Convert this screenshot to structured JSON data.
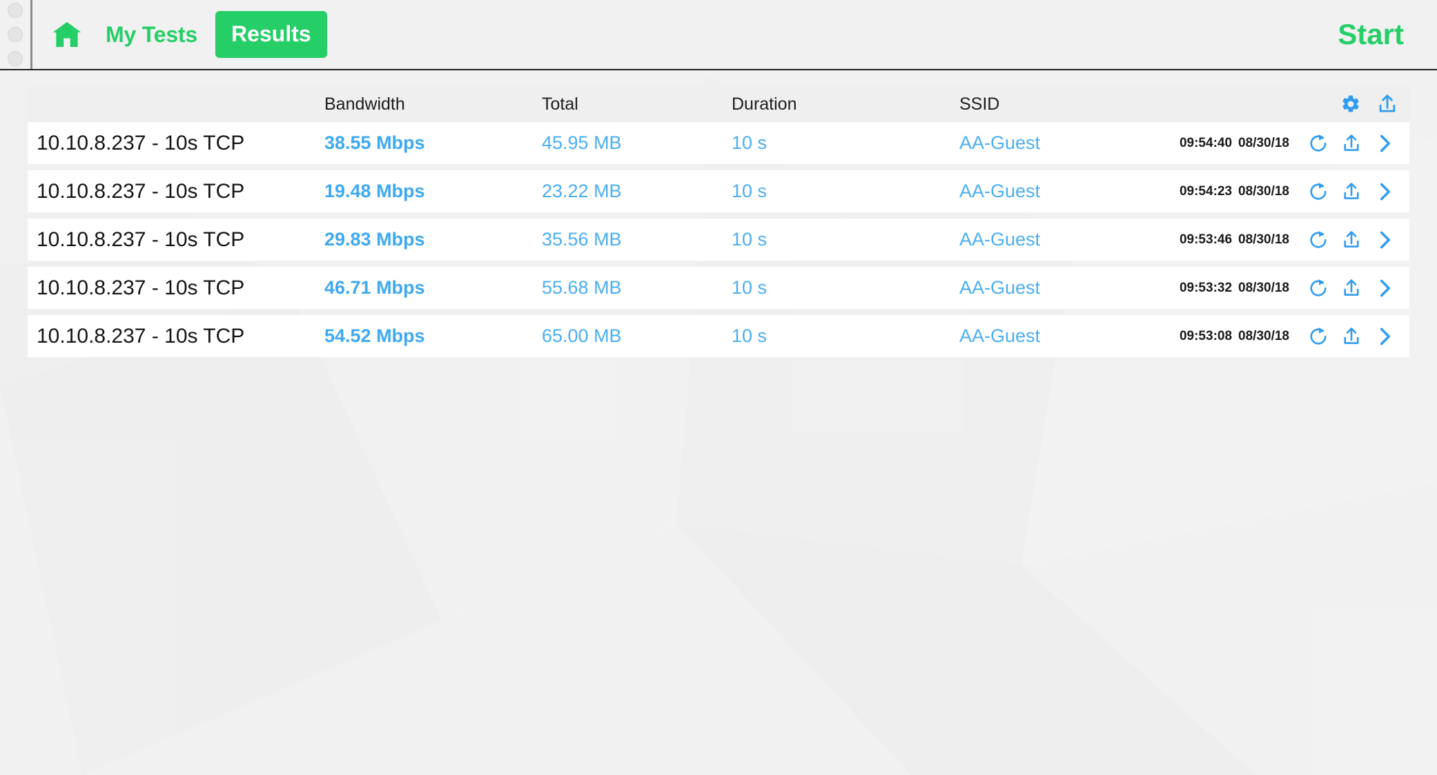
{
  "window_controls": {
    "dots": [
      "minimize-dot",
      "maximize-dot",
      "close-dot"
    ]
  },
  "topbar": {
    "home_label": "home-icon",
    "my_tests_label": "My Tests",
    "results_label": "Results",
    "start_label": "Start"
  },
  "colors": {
    "brand_green": "#26ce68",
    "link_blue": "#3fa9f0",
    "value_blue": "#4aaef2",
    "page_bg": "#f0f1f0",
    "row_bg": "#ffffff",
    "header_bg": "#eeefee",
    "text_dark": "#141414"
  },
  "table": {
    "columns": [
      {
        "key": "name",
        "label": ""
      },
      {
        "key": "bandwidth",
        "label": "Bandwidth"
      },
      {
        "key": "total",
        "label": "Total"
      },
      {
        "key": "duration",
        "label": "Duration"
      },
      {
        "key": "ssid",
        "label": "SSID"
      }
    ],
    "header_icons": [
      {
        "name": "settings-gear-icon",
        "label": "gear-icon"
      },
      {
        "name": "export-upload-icon",
        "label": "upload-icon"
      }
    ],
    "row_icons": [
      {
        "name": "rerun-refresh-icon",
        "label": "refresh-icon"
      },
      {
        "name": "share-upload-icon",
        "label": "upload-icon"
      },
      {
        "name": "details-chevron-icon",
        "label": "chevron-right-icon"
      }
    ],
    "rows": [
      {
        "name": "10.10.8.237 - 10s TCP",
        "bandwidth": "38.55 Mbps",
        "total": "45.95 MB",
        "duration": "10 s",
        "ssid": "AA-Guest",
        "time": "09:54:40",
        "date": "08/30/18"
      },
      {
        "name": "10.10.8.237 - 10s TCP",
        "bandwidth": "19.48 Mbps",
        "total": "23.22 MB",
        "duration": "10 s",
        "ssid": "AA-Guest",
        "time": "09:54:23",
        "date": "08/30/18"
      },
      {
        "name": "10.10.8.237 - 10s TCP",
        "bandwidth": "29.83 Mbps",
        "total": "35.56 MB",
        "duration": "10 s",
        "ssid": "AA-Guest",
        "time": "09:53:46",
        "date": "08/30/18"
      },
      {
        "name": "10.10.8.237 - 10s TCP",
        "bandwidth": "46.71 Mbps",
        "total": "55.68 MB",
        "duration": "10 s",
        "ssid": "AA-Guest",
        "time": "09:53:32",
        "date": "08/30/18"
      },
      {
        "name": "10.10.8.237 - 10s TCP",
        "bandwidth": "54.52 Mbps",
        "total": "65.00 MB",
        "duration": "10 s",
        "ssid": "AA-Guest",
        "time": "09:53:08",
        "date": "08/30/18"
      }
    ]
  }
}
